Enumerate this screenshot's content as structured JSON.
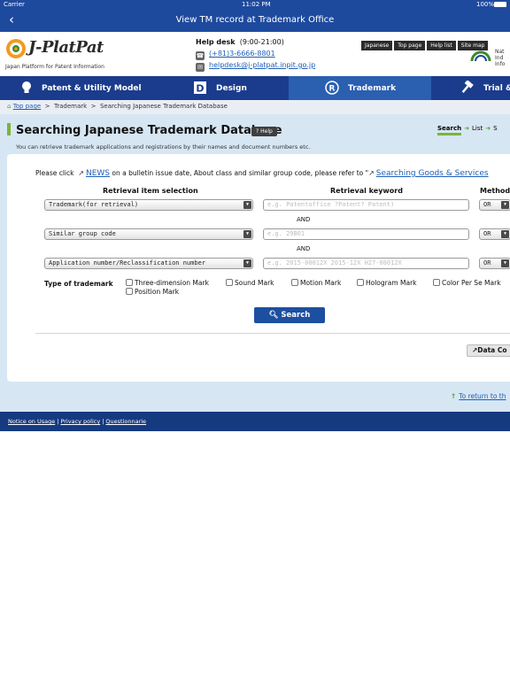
{
  "status_bar": {
    "carrier": "Carrier",
    "time": "11:02 PM",
    "battery": "100%"
  },
  "nav": {
    "title": "View TM record at Trademark Office",
    "back_icon": "chevron-left-icon"
  },
  "header": {
    "logo_text": "J-PlatPat",
    "logo_sub": "Japan Platform for Patent Information",
    "helpdesk_label": "Help desk",
    "helpdesk_hours": "(9:00-21:00)",
    "phone": "(+81)3-6666-8801",
    "email": "helpdesk@j-platpat.inpit.go.jp",
    "top_links": [
      "Japanese",
      "Top page",
      "Help list",
      "Site map"
    ],
    "inpit_label": "INPIT",
    "inpit_text": [
      "Nat",
      "Ind",
      "Info"
    ]
  },
  "tabs": [
    {
      "label": "Patent & Utility Model",
      "icon": "lightbulb-icon"
    },
    {
      "label": "Design",
      "icon": "design-icon"
    },
    {
      "label": "Trademark",
      "icon": "registered-icon"
    },
    {
      "label": "Trial & Appeal",
      "icon": "gavel-icon"
    }
  ],
  "breadcrumb": {
    "home": "Top page",
    "trademark": "Trademark",
    "current": "Searching Japanese Trademark Database"
  },
  "page": {
    "title": "Searching Japanese Trademark Database",
    "help": "Help",
    "description": "You can retrieve trademark applications and registrations by their names and document numbers etc.",
    "steps": [
      "Search",
      "List",
      "S"
    ]
  },
  "form": {
    "notice_prefix": "Please click",
    "notice_link": "NEWS",
    "notice_middle": "on a bulletin issue date, About class and similar group code, please refer to \"",
    "notice_link2": "Searching Goods & Services",
    "headers": {
      "item": "Retrieval item selection",
      "keyword": "Retrieval keyword",
      "method": "Method"
    },
    "rows": [
      {
        "item": "Trademark(for retrieval)",
        "placeholder": "e.g. Patentoffice ?Patent? Patent)",
        "method": "OR"
      },
      {
        "item": "Similar group code",
        "placeholder": "e.g. 29B01",
        "method": "OR"
      },
      {
        "item": "Application number/Reclassification number",
        "placeholder": "e.g. 2015-00012X 2015-12X H27-00012X",
        "method": "OR"
      }
    ],
    "and_label": "AND",
    "type_label": "Type of trademark",
    "types": [
      "Three-dimension Mark",
      "Sound Mark",
      "Motion Mark",
      "Hologram Mark",
      "Color Per Se Mark",
      "Position Mark"
    ],
    "search_label": "Search",
    "data_btn": "Data Co"
  },
  "return_link": "To return to th",
  "footer": {
    "links": [
      "Notice on Usage",
      "Privacy policy",
      "Questionnarie"
    ]
  }
}
